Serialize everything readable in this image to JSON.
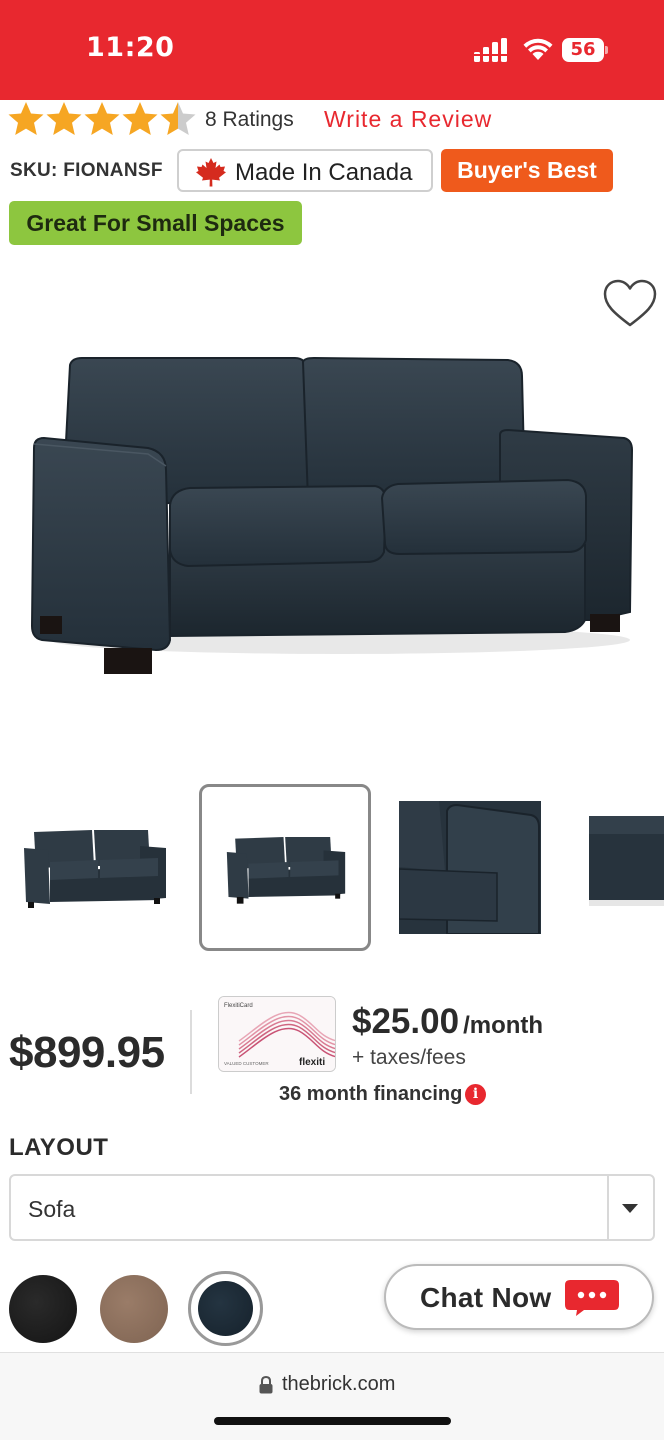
{
  "status_bar": {
    "time": "11:20",
    "battery": "56",
    "color": "#e8282f"
  },
  "product": {
    "rating_value": 4.5,
    "rating_max": 5,
    "ratings_count": "8 Ratings",
    "write_review": "Write a Review",
    "sku": "SKU: FIONANSF",
    "badges": {
      "made_in_canada": "Made In Canada",
      "buyers_best": "Buyer's Best",
      "small_spaces": "Great For Small Spaces"
    },
    "price": "$899.95",
    "financing": {
      "monthly_amount": "$25.00",
      "per": "/month",
      "taxes": "+ taxes/fees",
      "term": "36 month financing",
      "card_title": "FlexitiCard",
      "card_brand": "flexiti",
      "card_customer": "VALUED CUSTOMER"
    },
    "layout": {
      "label": "LAYOUT",
      "selected": "Sofa"
    },
    "swatches": [
      "black",
      "taupe",
      "navy"
    ],
    "selected_swatch": "navy"
  },
  "chat": {
    "label": "Chat Now"
  },
  "browser": {
    "url": "thebrick.com"
  },
  "colors": {
    "brand_red": "#e8282f",
    "star_orange": "#f6a623",
    "buyers_best_orange": "#ef5a1c",
    "small_spaces_green": "#8dc63f",
    "sofa_fabric": "#2a3640"
  }
}
